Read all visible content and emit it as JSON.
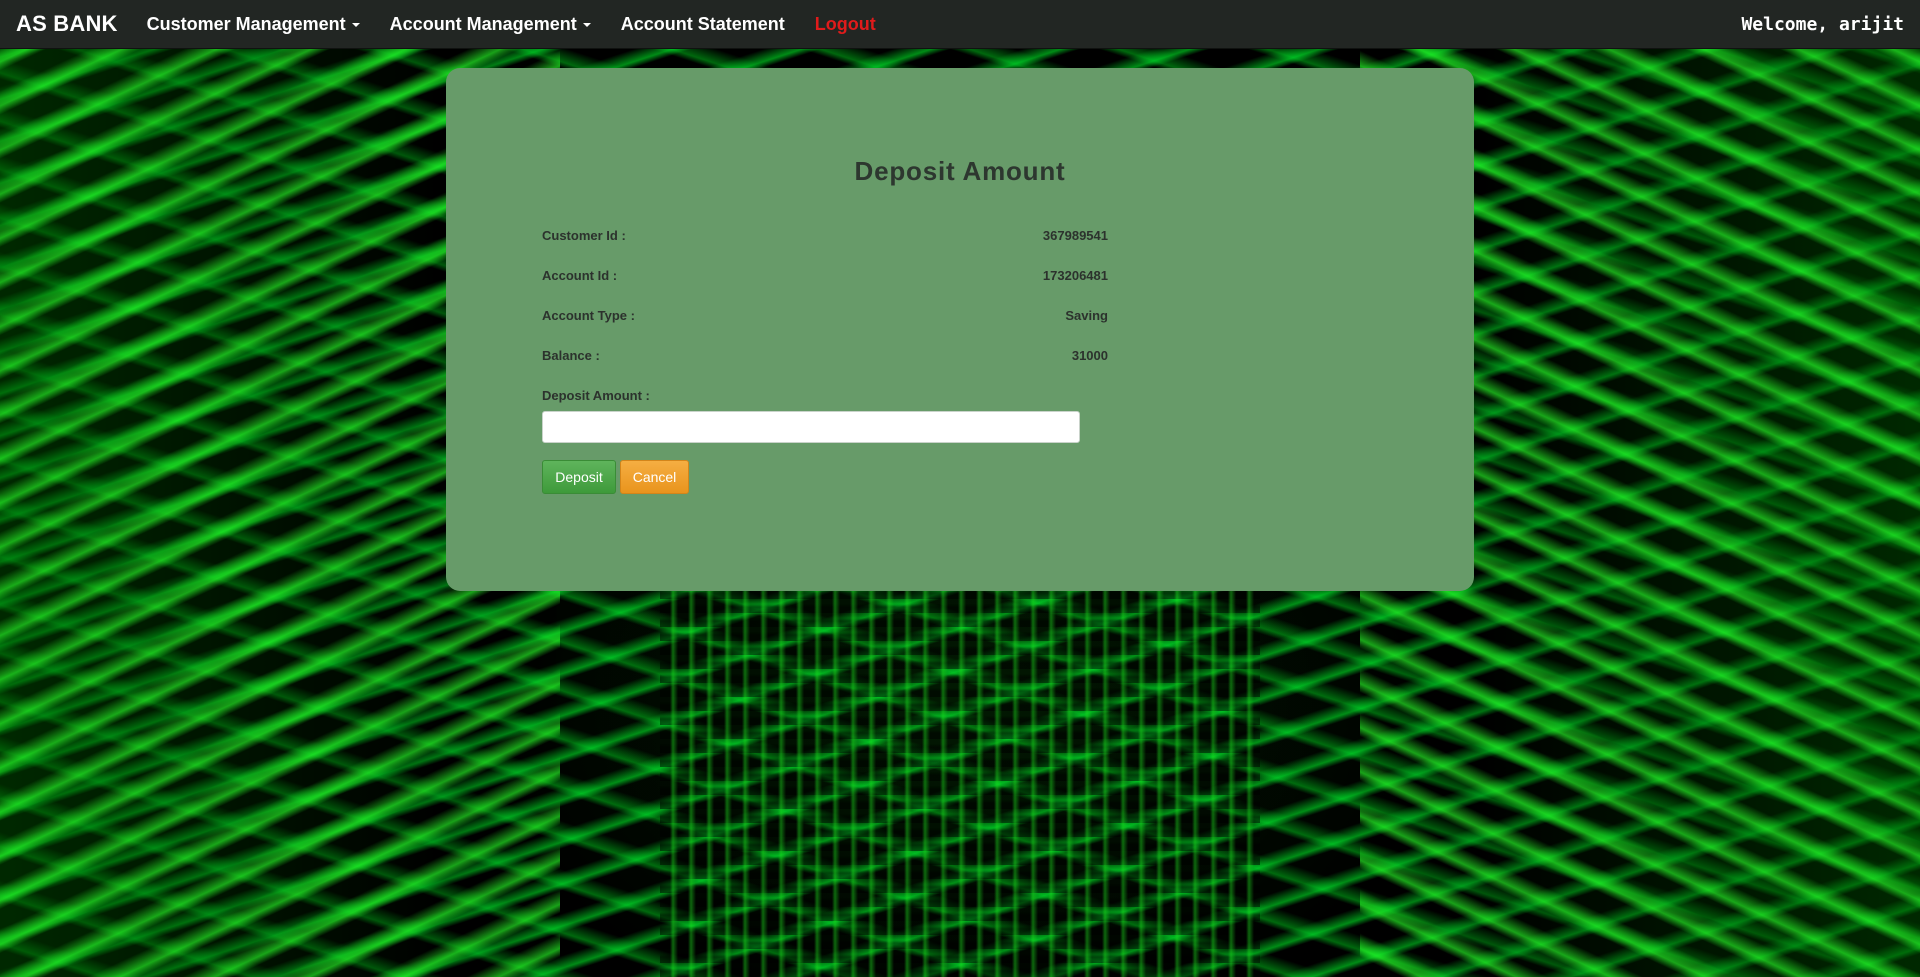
{
  "nav": {
    "brand": "AS BANK",
    "items": [
      {
        "label": "Customer Management",
        "dropdown": true
      },
      {
        "label": "Account Management",
        "dropdown": true
      },
      {
        "label": "Account Statement",
        "dropdown": false
      },
      {
        "label": "Logout",
        "dropdown": false
      }
    ],
    "welcome": "Welcome, arijit"
  },
  "form": {
    "title": "Deposit Amount",
    "fields": [
      {
        "label": "Customer Id :",
        "value": "367989541"
      },
      {
        "label": "Account Id :",
        "value": "173206481"
      },
      {
        "label": "Account Type :",
        "value": "Saving"
      },
      {
        "label": "Balance :",
        "value": "31000"
      }
    ],
    "deposit_label": "Deposit Amount :",
    "deposit_value": "",
    "deposit_placeholder": "",
    "buttons": {
      "deposit": "Deposit",
      "cancel": "Cancel"
    }
  },
  "colors": {
    "navbar": "#222623",
    "panel": "#679b69",
    "logout": "#e01b1b",
    "deposit_button": "#46a043",
    "cancel_button": "#eea031"
  }
}
